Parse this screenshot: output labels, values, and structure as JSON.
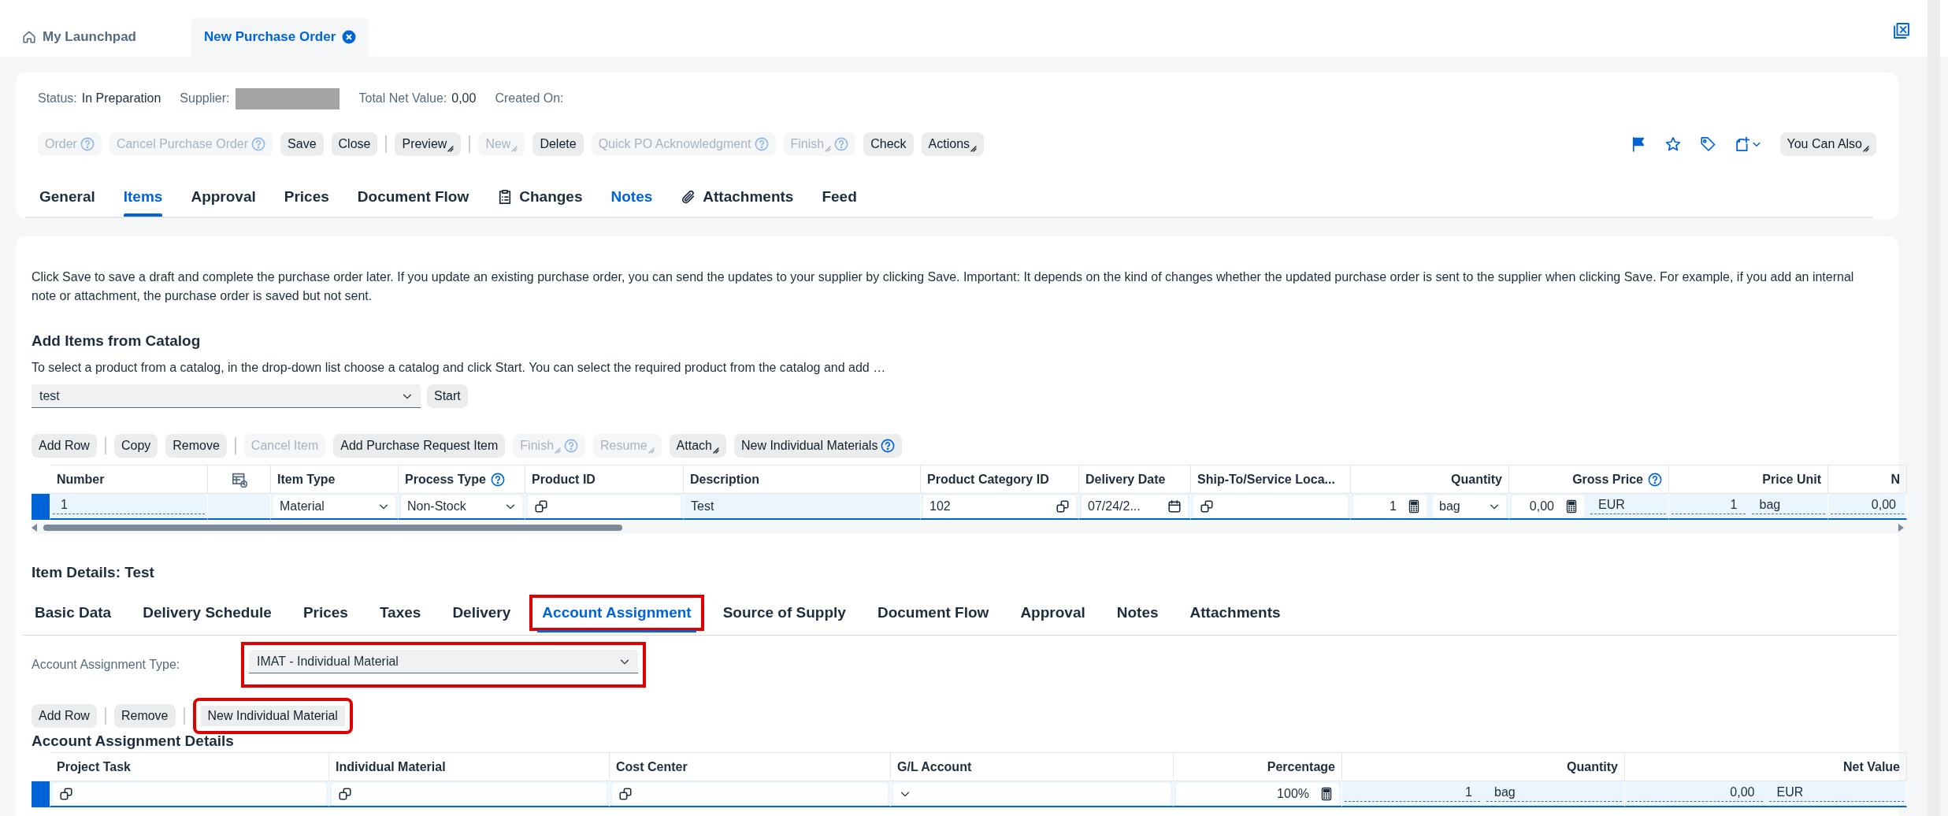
{
  "shell": {
    "tabs": [
      {
        "label": "My Launchpad",
        "kind": "home",
        "selected": false
      },
      {
        "label": "New Purchase Order",
        "kind": "closable",
        "selected": true
      }
    ]
  },
  "header": {
    "status": {
      "label": "Status:",
      "value": "In Preparation"
    },
    "supplier": {
      "label": "Supplier:",
      "redacted": true
    },
    "total": {
      "label": "Total Net Value:",
      "value": "0,00"
    },
    "created": {
      "label": "Created On:"
    },
    "toolbar": [
      {
        "kind": "button",
        "label": "Order",
        "disabled": true,
        "help": true,
        "menu": false
      },
      {
        "kind": "button",
        "label": "Cancel Purchase Order",
        "disabled": true,
        "help": true,
        "menu": false
      },
      {
        "kind": "button",
        "label": "Save",
        "disabled": false,
        "help": false,
        "menu": false
      },
      {
        "kind": "button",
        "label": "Close",
        "disabled": false,
        "help": false,
        "menu": false
      },
      {
        "kind": "separator"
      },
      {
        "kind": "button",
        "label": "Preview",
        "disabled": false,
        "help": false,
        "menu": true
      },
      {
        "kind": "separator"
      },
      {
        "kind": "button",
        "label": "New",
        "disabled": true,
        "help": false,
        "menu": true
      },
      {
        "kind": "button",
        "label": "Delete",
        "disabled": false,
        "help": false,
        "menu": false
      },
      {
        "kind": "button",
        "label": "Quick PO Acknowledgment",
        "disabled": true,
        "help": true,
        "menu": false
      },
      {
        "kind": "button",
        "label": "Finish",
        "disabled": true,
        "help": true,
        "menu": true
      },
      {
        "kind": "button",
        "label": "Check",
        "disabled": false,
        "help": false,
        "menu": false
      },
      {
        "kind": "button",
        "label": "Actions",
        "disabled": false,
        "help": false,
        "menu": true
      }
    ],
    "action_icons": [
      {
        "kind": "flag"
      },
      {
        "kind": "star"
      },
      {
        "kind": "tag"
      },
      {
        "kind": "new-document",
        "menu": true
      }
    ],
    "more": {
      "label": "You Can Also",
      "menu": true
    },
    "tabs": [
      {
        "label": "General",
        "kind": "text",
        "selected": false,
        "emphasized": false
      },
      {
        "label": "Items",
        "kind": "text",
        "selected": true,
        "emphasized": false
      },
      {
        "label": "Approval",
        "kind": "text",
        "selected": false,
        "emphasized": false
      },
      {
        "label": "Prices",
        "kind": "text",
        "selected": false,
        "emphasized": false
      },
      {
        "label": "Document Flow",
        "kind": "text",
        "selected": false,
        "emphasized": false
      },
      {
        "label": "Changes",
        "kind": "clipboard",
        "selected": false,
        "emphasized": false
      },
      {
        "label": "Notes",
        "kind": "text",
        "selected": false,
        "emphasized": true
      },
      {
        "label": "Attachments",
        "kind": "paperclip",
        "selected": false,
        "emphasized": false
      },
      {
        "label": "Feed",
        "kind": "text",
        "selected": false,
        "emphasized": false
      }
    ]
  },
  "content": {
    "info": "Click Save to save a draft and complete the purchase order later. If you update an existing purchase order, you can send the updates to your supplier by clicking Save. Important: It depends on the kind of changes whether the updated purchase order is sent to the supplier when clicking Save. For example, if you add an internal note or attachment, the purchase order is saved but not sent.",
    "catalog": {
      "title": "Add Items from Catalog",
      "description": "To select a product from a catalog, in the drop-down list choose a catalog and click Start. You can select the required product from the catalog and add …",
      "select": {
        "value": "test"
      },
      "start": "Start"
    },
    "items_toolbar": [
      {
        "kind": "button",
        "label": "Add Row",
        "disabled": false,
        "help": false,
        "menu": false
      },
      {
        "kind": "separator"
      },
      {
        "kind": "button",
        "label": "Copy",
        "disabled": false,
        "help": false,
        "menu": false
      },
      {
        "kind": "button",
        "label": "Remove",
        "disabled": false,
        "help": false,
        "menu": false
      },
      {
        "kind": "separator"
      },
      {
        "kind": "button",
        "label": "Cancel Item",
        "disabled": true,
        "help": false,
        "menu": false
      },
      {
        "kind": "button",
        "label": "Add Purchase Request Item",
        "disabled": false,
        "help": false,
        "menu": false
      },
      {
        "kind": "button",
        "label": "Finish",
        "disabled": true,
        "help": true,
        "menu": true
      },
      {
        "kind": "button",
        "label": "Resume",
        "disabled": true,
        "help": false,
        "menu": true
      },
      {
        "kind": "button",
        "label": "Attach",
        "disabled": false,
        "help": false,
        "menu": true
      },
      {
        "kind": "button",
        "label": "New Individual Materials",
        "disabled": false,
        "help": true,
        "menu": false
      }
    ],
    "items_table": {
      "columns": [
        {
          "kind": "text",
          "header": "Number",
          "help": false
        },
        {
          "kind": "icon"
        },
        {
          "kind": "text",
          "header": "Item Type",
          "help": false
        },
        {
          "kind": "text",
          "header": "Process Type",
          "help": true
        },
        {
          "kind": "text",
          "header": "Product ID",
          "help": false
        },
        {
          "kind": "text",
          "header": "Description",
          "help": false
        },
        {
          "kind": "text",
          "header": "Product Category ID",
          "help": false
        },
        {
          "kind": "text",
          "header": "Delivery Date",
          "help": false
        },
        {
          "kind": "text",
          "header": "Ship-To/Service Loca...",
          "help": false
        },
        {
          "kind": "numeric",
          "header": "Quantity",
          "help": false
        },
        {
          "kind": "numeric",
          "header": "Gross Price",
          "help": true
        },
        {
          "kind": "numeric",
          "header": "Price Unit",
          "help": false
        },
        {
          "kind": "numeric",
          "header": "N",
          "help": false
        }
      ],
      "rows": [
        {
          "selected": true,
          "cells": [
            {
              "parts": [
                {
                  "kind": "input",
                  "value": "1"
                }
              ]
            },
            {},
            {
              "parts": [
                {
                  "kind": "select",
                  "value": "Material"
                }
              ]
            },
            {
              "parts": [
                {
                  "kind": "select",
                  "value": "Non-Stock"
                }
              ]
            },
            {
              "parts": [
                {
                  "kind": "valuehelp"
                }
              ]
            },
            {
              "parts": [
                {
                  "kind": "text",
                  "value": "Test"
                }
              ]
            },
            {
              "parts": [
                {
                  "kind": "valuehelp",
                  "value": "102"
                }
              ]
            },
            {
              "parts": [
                {
                  "kind": "date",
                  "value": "07/24/2..."
                }
              ]
            },
            {
              "parts": [
                {
                  "kind": "valuehelp"
                }
              ]
            },
            {
              "parts": [
                {
                  "kind": "calc",
                  "value": "1"
                },
                {
                  "kind": "select",
                  "value": "bag"
                }
              ]
            },
            {
              "parts": [
                {
                  "kind": "calc",
                  "value": "0,00"
                },
                {
                  "kind": "input",
                  "value": "EUR"
                }
              ]
            },
            {
              "parts": [
                {
                  "kind": "number",
                  "value": "1"
                },
                {
                  "kind": "input",
                  "value": "bag"
                }
              ]
            },
            {
              "parts": [
                {
                  "kind": "number",
                  "value": "0,00"
                }
              ]
            }
          ]
        }
      ]
    },
    "details": {
      "title": "Item Details: Test",
      "tabs": [
        {
          "label": "Basic Data",
          "selected": false,
          "highlighted": false
        },
        {
          "label": "Delivery Schedule",
          "selected": false,
          "highlighted": false
        },
        {
          "label": "Prices",
          "selected": false,
          "highlighted": false
        },
        {
          "label": "Taxes",
          "selected": false,
          "highlighted": false
        },
        {
          "label": "Delivery",
          "selected": false,
          "highlighted": false
        },
        {
          "label": "Account Assignment",
          "selected": true,
          "highlighted": true
        },
        {
          "label": "Source of Supply",
          "selected": false,
          "highlighted": false
        },
        {
          "label": "Document Flow",
          "selected": false,
          "highlighted": false
        },
        {
          "label": "Approval",
          "selected": false,
          "highlighted": false
        },
        {
          "label": "Notes",
          "selected": false,
          "highlighted": false
        },
        {
          "label": "Attachments",
          "selected": false,
          "highlighted": false
        }
      ],
      "assignment_type": {
        "label": "Account Assignment Type:",
        "value": "IMAT - Individual Material",
        "highlighted": true
      },
      "toolbar": [
        {
          "kind": "button",
          "label": "Add Row",
          "disabled": false,
          "help": false,
          "menu": false,
          "highlighted": false
        },
        {
          "kind": "separator"
        },
        {
          "kind": "button",
          "label": "Remove",
          "disabled": false,
          "help": false,
          "menu": false,
          "highlighted": false
        },
        {
          "kind": "separator"
        },
        {
          "kind": "button",
          "label": "New Individual Material",
          "disabled": false,
          "help": false,
          "menu": false,
          "highlighted": true
        }
      ],
      "table_title": "Account Assignment Details",
      "table": {
        "columns": [
          {
            "kind": "text",
            "header": "Project Task",
            "help": false
          },
          {
            "kind": "text",
            "header": "Individual Material",
            "help": false
          },
          {
            "kind": "text",
            "header": "Cost Center",
            "help": false
          },
          {
            "kind": "text",
            "header": "G/L Account",
            "help": false
          },
          {
            "kind": "numeric",
            "header": "Percentage",
            "help": false
          },
          {
            "kind": "numeric",
            "header": "Quantity",
            "help": false
          },
          {
            "kind": "numeric",
            "header": "Net Value",
            "help": false
          }
        ],
        "rows": [
          {
            "selected": true,
            "cells": [
              {
                "parts": [
                  {
                    "kind": "valuehelp"
                  }
                ]
              },
              {
                "parts": [
                  {
                    "kind": "valuehelp"
                  }
                ]
              },
              {
                "parts": [
                  {
                    "kind": "valuehelp"
                  }
                ]
              },
              {
                "parts": [
                  {
                    "kind": "select"
                  }
                ]
              },
              {
                "parts": [
                  {
                    "kind": "calc",
                    "value": "100%"
                  }
                ]
              },
              {
                "parts": [
                  {
                    "kind": "number",
                    "value": "1"
                  },
                  {
                    "kind": "input",
                    "value": "bag"
                  }
                ]
              },
              {
                "parts": [
                  {
                    "kind": "number",
                    "value": "0,00"
                  },
                  {
                    "kind": "input",
                    "value": "EUR"
                  }
                ]
              }
            ]
          }
        ]
      }
    }
  }
}
